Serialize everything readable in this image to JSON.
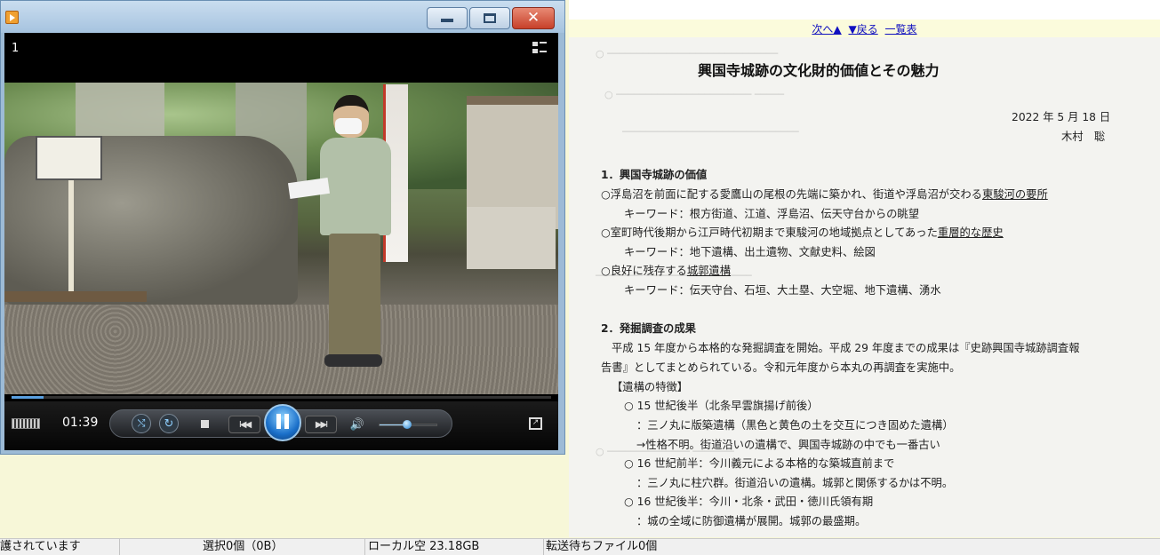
{
  "document": {
    "nav": {
      "next": "次へ▲",
      "back": "▼戻る",
      "list": "一覧表"
    },
    "title": "興国寺城跡の文化財的価値とその魅力",
    "date": "2022 年 5 月 18 日",
    "author": "木村　聡",
    "lines": [
      "1．興国寺城跡の価値",
      "○浮島沼を前面に配する愛鷹山の尾根の先端に築かれ、街道や浮島沼が交わる",
      "東駿河の要所",
      "キーワード：根方街道、江道、浮島沼、伝天守台からの眺望",
      "○室町時代後期から江戸時代初期まで東駿河の地域拠点としてあった",
      "重層的な歴史",
      "キーワード：地下遺構、出土遺物、文献史料、絵図",
      "○良好に残存する",
      "城郭遺構",
      "キーワード：伝天守台、石垣、大土塁、大空堀、地下遺構、湧水",
      "2．発掘調査の成果",
      "平成 15 年度から本格的な発掘調査を開始。平成 29 年度までの成果は『史跡興国寺城跡調査報",
      "告書』としてまとめられている。令和元年度から本丸の再調査を実施中。",
      "【遺構の特徴】",
      "○ 15 世紀後半（北条早雲旗揚げ前後）",
      "：三ノ丸に版築遺構（黒色と黄色の土を交互につき固めた遺構）",
      "→性格不明。街道沿いの遺構で、興国寺城跡の中でも一番古い",
      "○ 16 世紀前半：今川義元による本格的な築城直前まで",
      "：三ノ丸に柱穴群。街道沿いの遺構。城郭と関係するかは不明。",
      "○ 16 世紀後半：今川・北条・武田・徳川氏領有期",
      "：城の全域に防御遺構が展開。城郭の最盛期。"
    ]
  },
  "player": {
    "chapter": "1",
    "time": "01:39",
    "progress": 0.06,
    "volume": 0.48,
    "icons": {
      "app": "media-player-icon",
      "minimize": "minimize-icon",
      "maximize": "maximize-icon",
      "close": "close-icon",
      "switch_view": "switch-to-library-icon",
      "shuffle": "shuffle-icon",
      "repeat": "repeat-icon",
      "stop": "stop-icon",
      "previous": "previous-icon",
      "pause": "pause-icon",
      "next": "next-icon",
      "mute": "speaker-icon",
      "fullscreen": "fullscreen-icon"
    },
    "shuffle_glyph": "⤭",
    "repeat_glyph": "↻",
    "prev_glyph": "I◀◀",
    "next_glyph": "▶▶I",
    "mute_glyph": "🔊",
    "fullscreen_glyph": "↗",
    "close_glyph": "✕"
  },
  "statusbar": {
    "left": "護されています",
    "selection": "選択0個（0B）",
    "local": "ローカル空 23.18GB",
    "transfer": "転送待ちファイル0個"
  }
}
